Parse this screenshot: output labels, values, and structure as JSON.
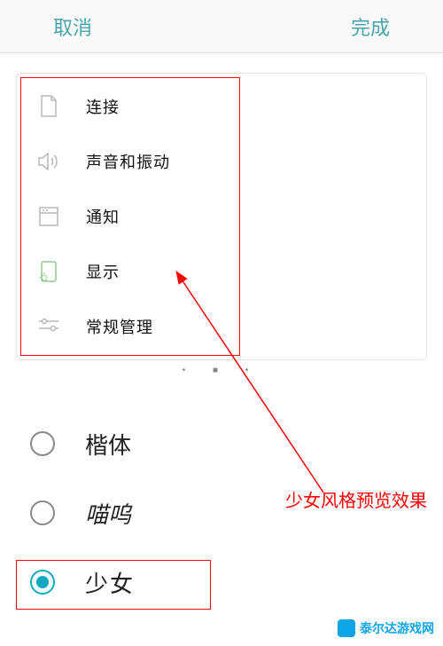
{
  "header": {
    "cancel": "取消",
    "done": "完成"
  },
  "preview": {
    "items": [
      {
        "icon": "file-icon",
        "label": "连接"
      },
      {
        "icon": "sound-icon",
        "label": "声音和振动"
      },
      {
        "icon": "notification-icon",
        "label": "通知"
      },
      {
        "icon": "display-icon",
        "label": "显示"
      },
      {
        "icon": "settings-icon",
        "label": "常规管理"
      }
    ]
  },
  "fonts": {
    "options": [
      {
        "label": "楷体",
        "selected": false
      },
      {
        "label": "喵呜",
        "selected": false
      },
      {
        "label": "少女",
        "selected": true
      }
    ]
  },
  "annotation": {
    "text": "少女风格预览效果"
  },
  "watermark": {
    "text": "泰尔达游戏网"
  }
}
